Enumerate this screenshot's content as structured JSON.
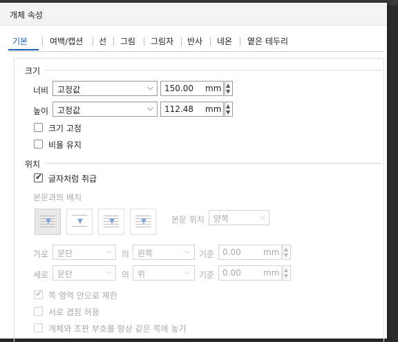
{
  "dialog": {
    "title": "개체 속성"
  },
  "tabs": [
    "기본",
    "여백/캡션",
    "선",
    "그림",
    "그림자",
    "반사",
    "네온",
    "옅은 테두리"
  ],
  "size": {
    "section": "크기",
    "width_label": "너비",
    "width_mode": "고정값",
    "width_value": "150.00",
    "height_label": "높이",
    "height_mode": "고정값",
    "height_value": "112.48",
    "unit": "mm",
    "lock_size": "크기 고정",
    "keep_ratio": "비율 유지"
  },
  "position": {
    "section": "위치",
    "treat_as_char": "글자처럼 취급",
    "wrap_label": "본문과의 배치",
    "body_position_label": "본문 위치",
    "body_position_value": "양쪽",
    "horizontal_label": "가로",
    "horizontal_ref": "문단",
    "of_label": "의",
    "horizontal_align": "왼쪽",
    "base_label": "기준",
    "horizontal_offset": "0.00",
    "vertical_label": "세로",
    "vertical_ref": "문단",
    "vertical_align": "위",
    "vertical_offset": "0.00",
    "unit": "mm",
    "limit_in_page": "쪽 영역 안으로 제한",
    "allow_overlap": "서로 겹침 허용",
    "same_page_as_ref": "개체와 조판 부호를 항상 같은 쪽에 놓기"
  },
  "state": {
    "active_tab": "기본",
    "treat_as_char_checked": true,
    "limit_in_page_checked": true,
    "selected_wrap": "wrap-square"
  },
  "colors": {
    "accent": "#1a5fb4",
    "disabled_text": "#a9a9a9"
  },
  "icons": [
    "chevron-down-icon",
    "spin-up-icon",
    "spin-down-icon",
    "check-icon"
  ]
}
